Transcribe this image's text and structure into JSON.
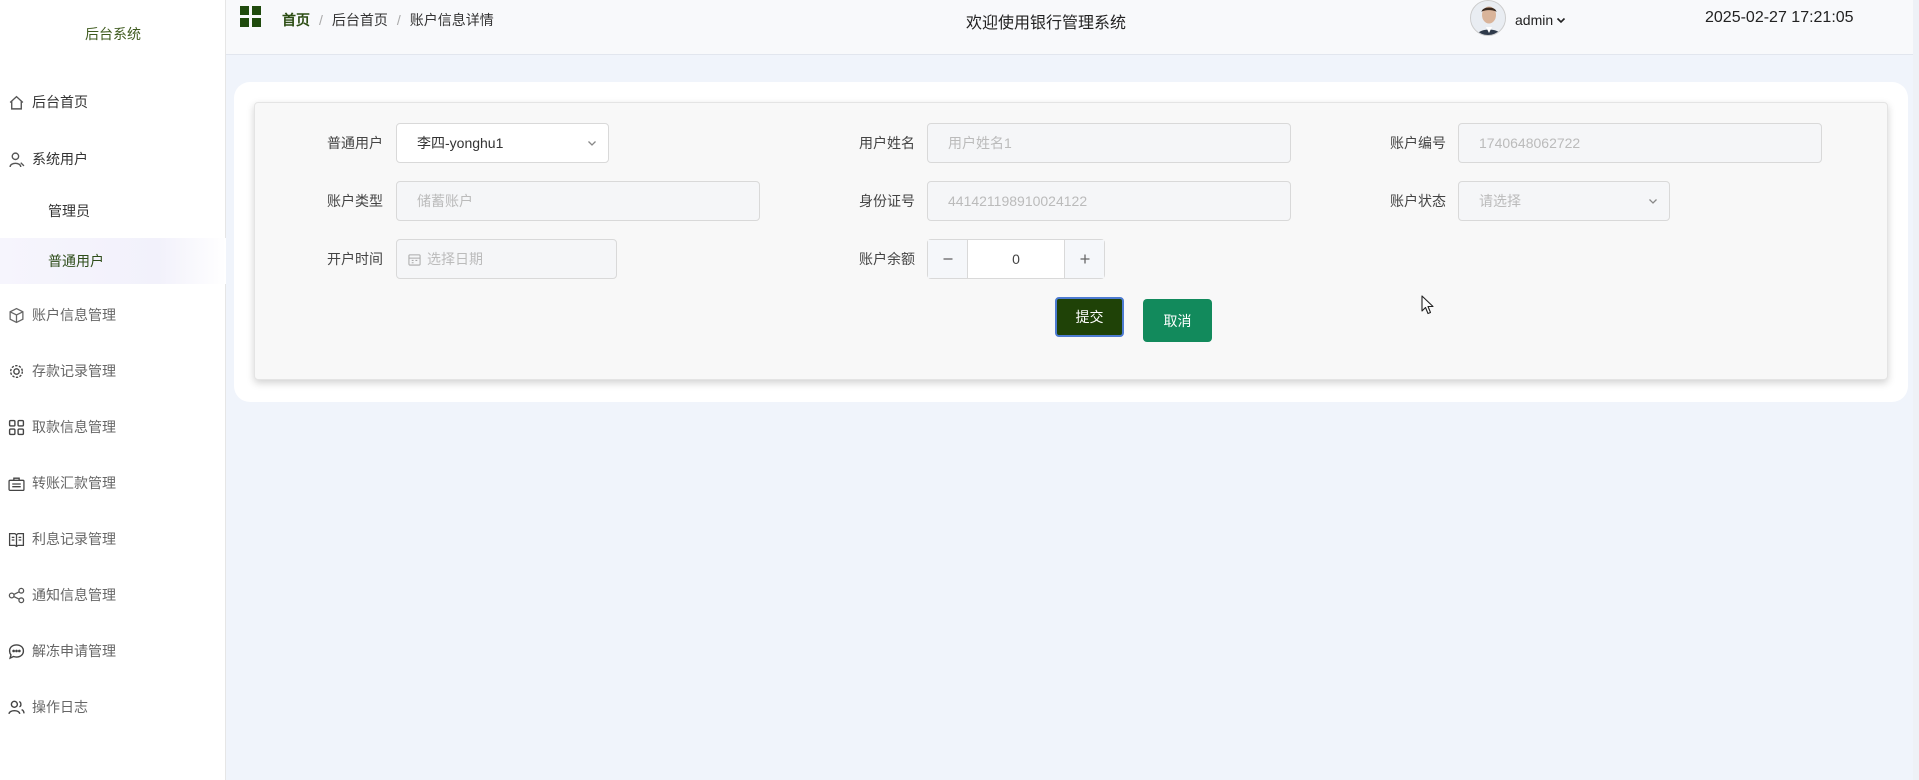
{
  "sidebar": {
    "brand": "后台系统",
    "items": [
      {
        "label": "后台首页",
        "icon": "home-icon"
      },
      {
        "label": "系统用户",
        "icon": "user-icon"
      },
      {
        "label": "管理员"
      },
      {
        "label": "普通用户"
      },
      {
        "label": "账户信息管理",
        "icon": "box-icon"
      },
      {
        "label": "存款记录管理",
        "icon": "gear-icon"
      },
      {
        "label": "取款信息管理",
        "icon": "grid-icon"
      },
      {
        "label": "转账汇款管理",
        "icon": "briefcase-icon"
      },
      {
        "label": "利息记录管理",
        "icon": "book-icon"
      },
      {
        "label": "通知信息管理",
        "icon": "share-icon"
      },
      {
        "label": "解冻申请管理",
        "icon": "chat-icon"
      },
      {
        "label": "操作日志",
        "icon": "users-icon"
      }
    ],
    "accent_color": "#3e5a1e"
  },
  "header": {
    "breadcrumb": [
      "首页",
      "后台首页",
      "账户信息详情"
    ],
    "title": "欢迎使用银行管理系统",
    "username": "admin",
    "datetime": "2025-02-27 17:21:05"
  },
  "form": {
    "user": {
      "label": "普通用户",
      "value": "李四-yonghu1"
    },
    "name": {
      "label": "用户姓名",
      "placeholder": "用户姓名1"
    },
    "account_no": {
      "label": "账户编号",
      "placeholder": "1740648062722"
    },
    "account_type": {
      "label": "账户类型",
      "placeholder": "储蓄账户"
    },
    "id_no": {
      "label": "身份证号",
      "placeholder": "441421198910024122"
    },
    "status": {
      "label": "账户状态",
      "placeholder": "请选择"
    },
    "open_time": {
      "label": "开户时间",
      "placeholder": "选择日期"
    },
    "balance": {
      "label": "账户余额",
      "value": "0"
    }
  },
  "actions": {
    "submit": "提交",
    "cancel": "取消"
  },
  "colors": {
    "submit_bg": "#1f4207",
    "cancel_bg": "#128a5c",
    "page_bg": "#f0f4fb"
  }
}
